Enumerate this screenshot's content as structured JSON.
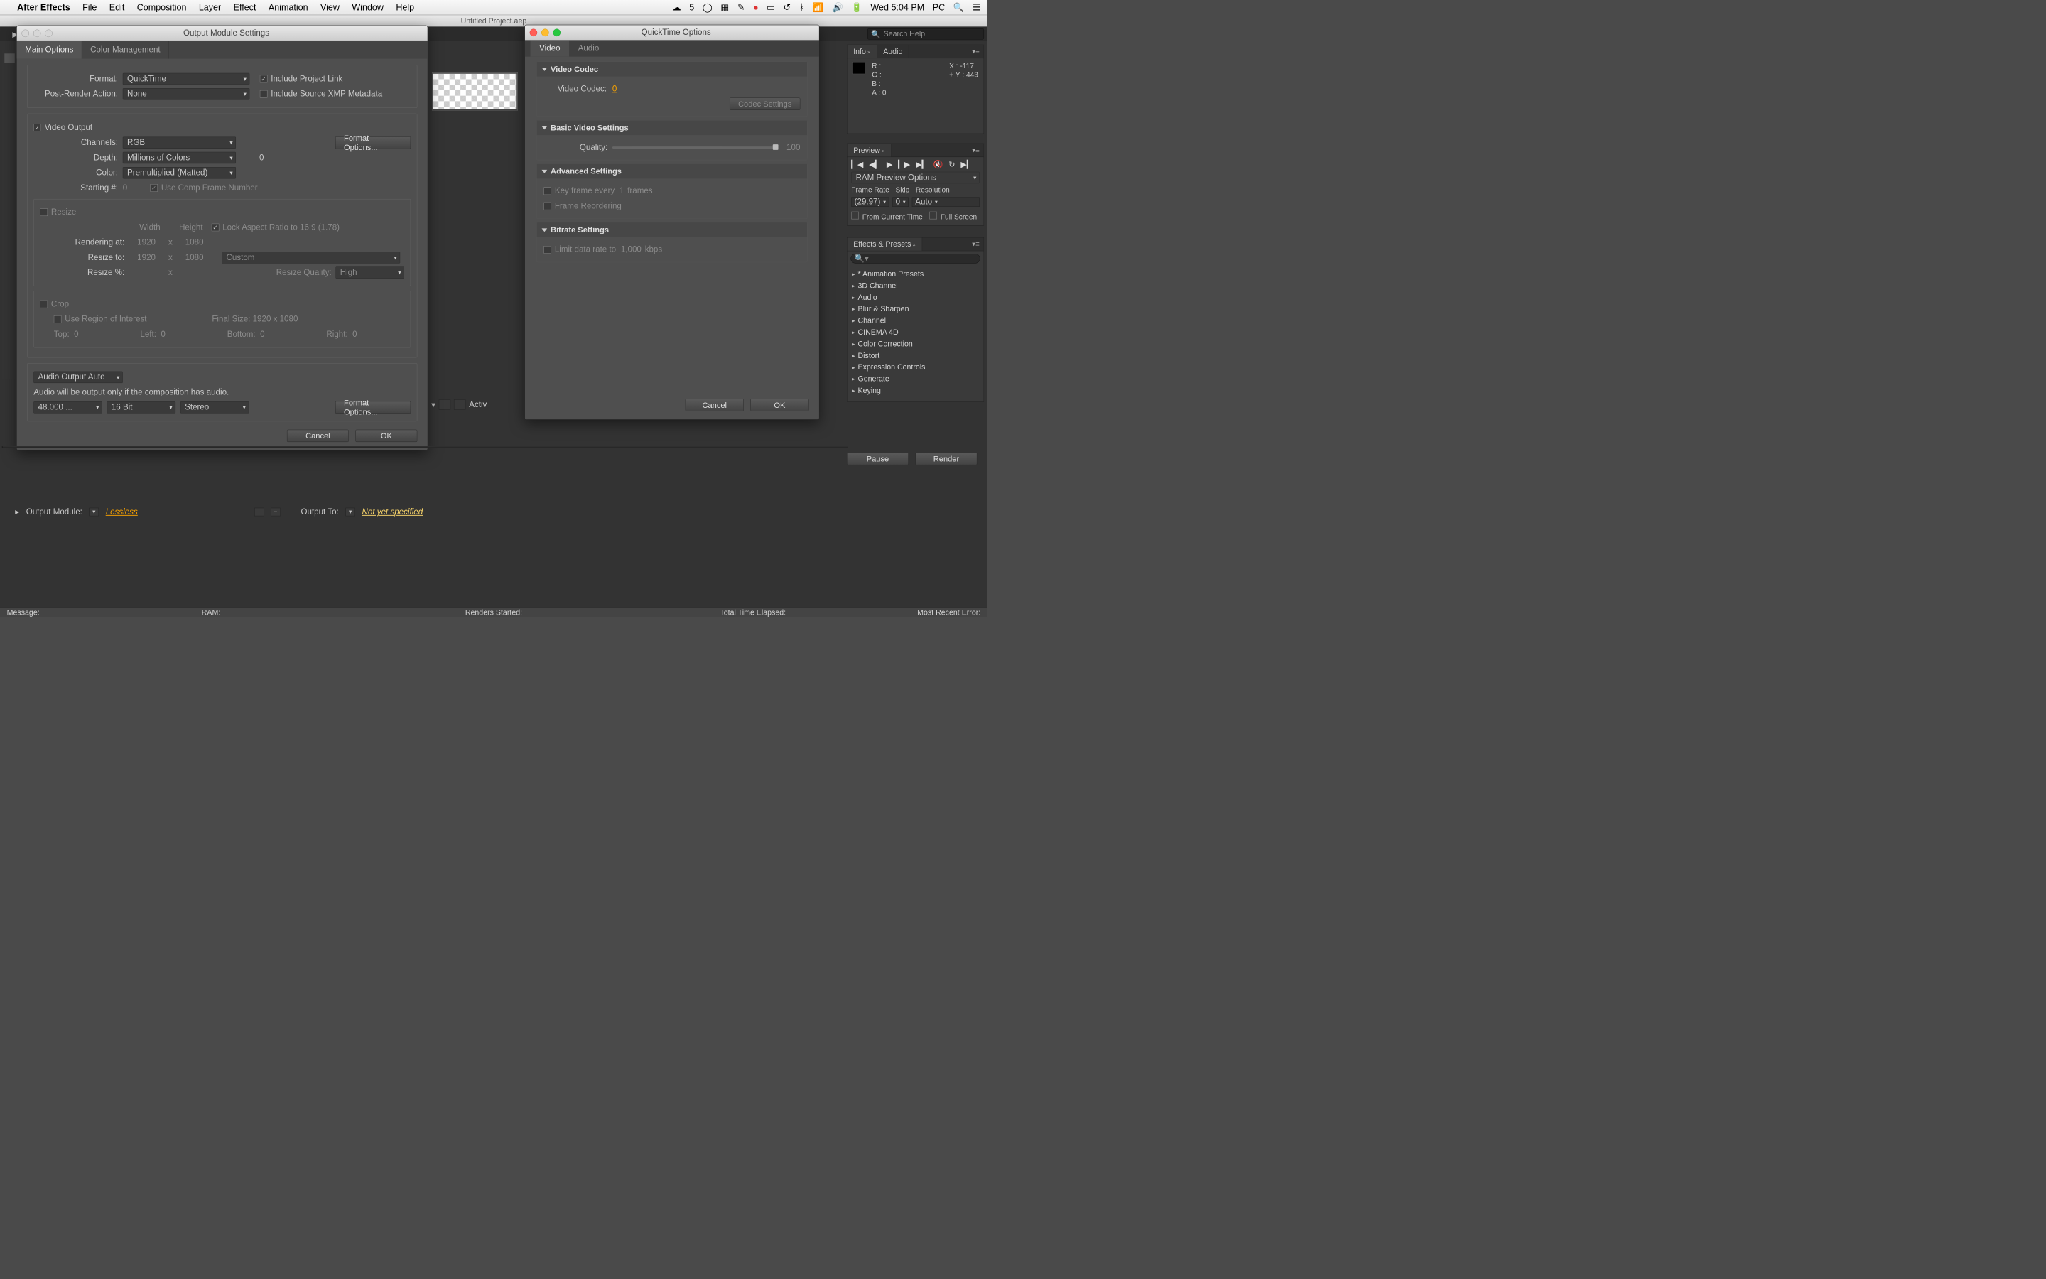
{
  "menubar": {
    "app": "After Effects",
    "items": [
      "File",
      "Edit",
      "Composition",
      "Layer",
      "Effect",
      "Animation",
      "View",
      "Window",
      "Help"
    ],
    "notif": "5",
    "clock": "Wed 5:04 PM",
    "user": "PC"
  },
  "window_title": "Untitled Project.aep",
  "search_help": "Search Help",
  "output_dialog": {
    "title": "Output Module Settings",
    "tabs": {
      "main": "Main Options",
      "color": "Color Management"
    },
    "format_label": "Format:",
    "format_value": "QuickTime",
    "include_link": "Include Project Link",
    "post_render_label": "Post-Render Action:",
    "post_render_value": "None",
    "include_xmp": "Include Source XMP Metadata",
    "video_output": "Video Output",
    "channels_label": "Channels:",
    "channels_value": "RGB",
    "format_options_btn": "Format Options...",
    "depth_label": "Depth:",
    "depth_value": "Millions of Colors",
    "depth_extra": "0",
    "color_label": "Color:",
    "color_value": "Premultiplied (Matted)",
    "starting_label": "Starting #:",
    "starting_value": "0",
    "use_comp_frame": "Use Comp Frame Number",
    "resize": {
      "title": "Resize",
      "width": "Width",
      "height": "Height",
      "lock": "Lock Aspect Ratio to 16:9 (1.78)",
      "rendering_at": "Rendering at:",
      "r_w": "1920",
      "r_h": "1080",
      "resize_to": "Resize to:",
      "t_w": "1920",
      "t_h": "1080",
      "custom": "Custom",
      "resize_pct": "Resize %:",
      "quality_label": "Resize Quality:",
      "quality_value": "High",
      "x": "x"
    },
    "crop": {
      "title": "Crop",
      "use_roi": "Use Region of Interest",
      "final_size": "Final Size: 1920 x 1080",
      "top": "Top:",
      "tv": "0",
      "left": "Left:",
      "lv": "0",
      "bottom": "Bottom:",
      "bv": "0",
      "right": "Right:",
      "rv": "0"
    },
    "audio": {
      "mode": "Audio Output Auto",
      "note": "Audio will be output only if the composition has audio.",
      "rate": "48.000 ...",
      "bit": "16 Bit",
      "ch": "Stereo",
      "format_options": "Format Options..."
    },
    "cancel": "Cancel",
    "ok": "OK"
  },
  "qt_dialog": {
    "title": "QuickTime Options",
    "tabs": {
      "video": "Video",
      "audio": "Audio"
    },
    "codec_section": "Video Codec",
    "codec_label": "Video Codec:",
    "codec_value": "0",
    "codec_settings": "Codec Settings",
    "basic_section": "Basic Video Settings",
    "quality_label": "Quality:",
    "quality_value": "100",
    "adv_section": "Advanced Settings",
    "keyframe_label": "Key frame every",
    "keyframe_value": "1",
    "keyframe_unit": "frames",
    "reorder": "Frame Reordering",
    "bitrate_section": "Bitrate Settings",
    "limit_label": "Limit data rate to",
    "limit_value": "1,000",
    "limit_unit": "kbps",
    "cancel": "Cancel",
    "ok": "OK"
  },
  "info": {
    "tab_info": "Info",
    "tab_audio": "Audio",
    "R": "R :",
    "G": "G :",
    "B": "B :",
    "A": "A : 0",
    "X": "X : -117",
    "Y": "Y : 443"
  },
  "preview": {
    "tab": "Preview",
    "ram": "RAM Preview Options",
    "fr_label": "Frame Rate",
    "skip_label": "Skip",
    "res_label": "Resolution",
    "fr_value": "(29.97)",
    "skip_value": "0",
    "res_value": "Auto",
    "from_current": "From Current Time",
    "full_screen": "Full Screen"
  },
  "effects": {
    "tab": "Effects & Presets",
    "items": [
      "* Animation Presets",
      "3D Channel",
      "Audio",
      "Blur & Sharpen",
      "Channel",
      "CINEMA 4D",
      "Color Correction",
      "Distort",
      "Expression Controls",
      "Generate",
      "Keying"
    ]
  },
  "render_buttons": {
    "pause": "Pause",
    "render": "Render"
  },
  "output_module_row": {
    "label": "Output Module:",
    "value": "Lossless",
    "output_to": "Output To:",
    "nys": "Not yet specified"
  },
  "viewer": {
    "active": "Activ"
  },
  "status": {
    "message": "Message:",
    "ram": "RAM:",
    "renders": "Renders Started:",
    "elapsed": "Total Time Elapsed:",
    "error": "Most Recent Error:"
  }
}
